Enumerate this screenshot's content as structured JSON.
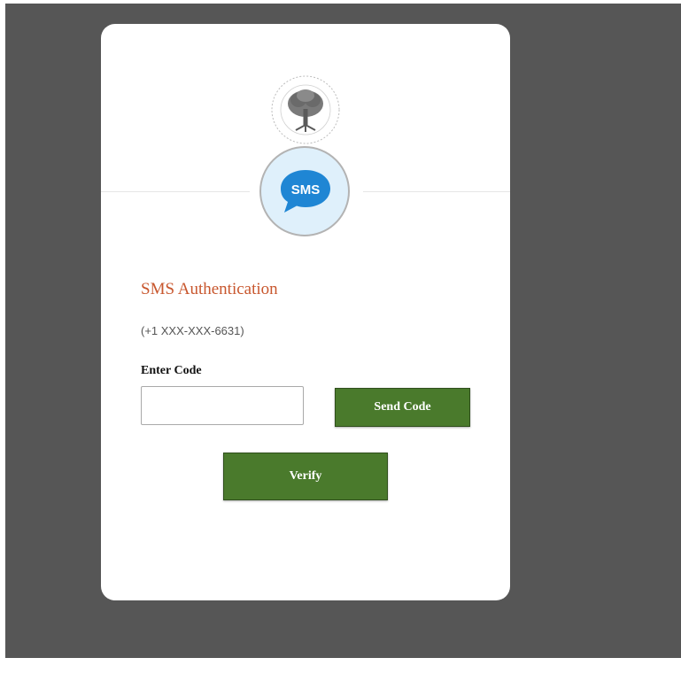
{
  "card": {
    "title": "SMS Authentication",
    "phone": "(+1 XXX-XXX-6631)",
    "code_label": "Enter Code",
    "code_input": {
      "value": "",
      "placeholder": ""
    },
    "send_code_label": "Send Code",
    "verify_label": "Verify",
    "sms_badge_text": "SMS"
  },
  "colors": {
    "backdrop": "#565656",
    "title": "#c8572e",
    "button": "#4a7a2c",
    "sms_bubble": "#1f86d4"
  },
  "icons": {
    "logo": "clearinghouse-tree-seal-icon",
    "sms": "sms-chat-bubble-icon"
  }
}
